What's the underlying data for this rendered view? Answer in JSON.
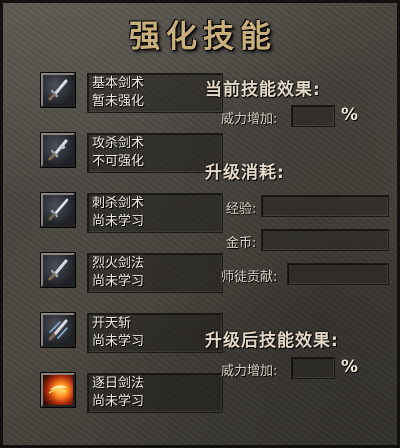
{
  "title": "强化技能",
  "skills": [
    {
      "name": "基本剑术",
      "status": "暂未强化",
      "icon": "sword-icon"
    },
    {
      "name": "攻杀剑术",
      "status": "不可强化",
      "icon": "sword-icon"
    },
    {
      "name": "刺杀剑术",
      "status": "尚未学习",
      "icon": "sword-icon"
    },
    {
      "name": "烈火剑法",
      "status": "尚未学习",
      "icon": "sword-icon"
    },
    {
      "name": "开天斩",
      "status": "尚未学习",
      "icon": "sword-slash-icon"
    },
    {
      "name": "逐日剑法",
      "status": "尚未学习",
      "icon": "fire-sword-icon"
    }
  ],
  "current_effect": {
    "heading": "当前技能效果:",
    "power_label": "威力增加:",
    "percent": "%"
  },
  "upgrade_cost": {
    "heading": "升级消耗:",
    "exp_label": "经验:",
    "gold_label": "金币:",
    "contribution_label": "师徒贡献:"
  },
  "after_effect": {
    "heading": "升级后技能效果:",
    "power_label": "威力增加:",
    "percent": "%"
  },
  "colors": {
    "title": "#c9b07a",
    "text": "#f1ece2",
    "panel": "#4a4741"
  }
}
